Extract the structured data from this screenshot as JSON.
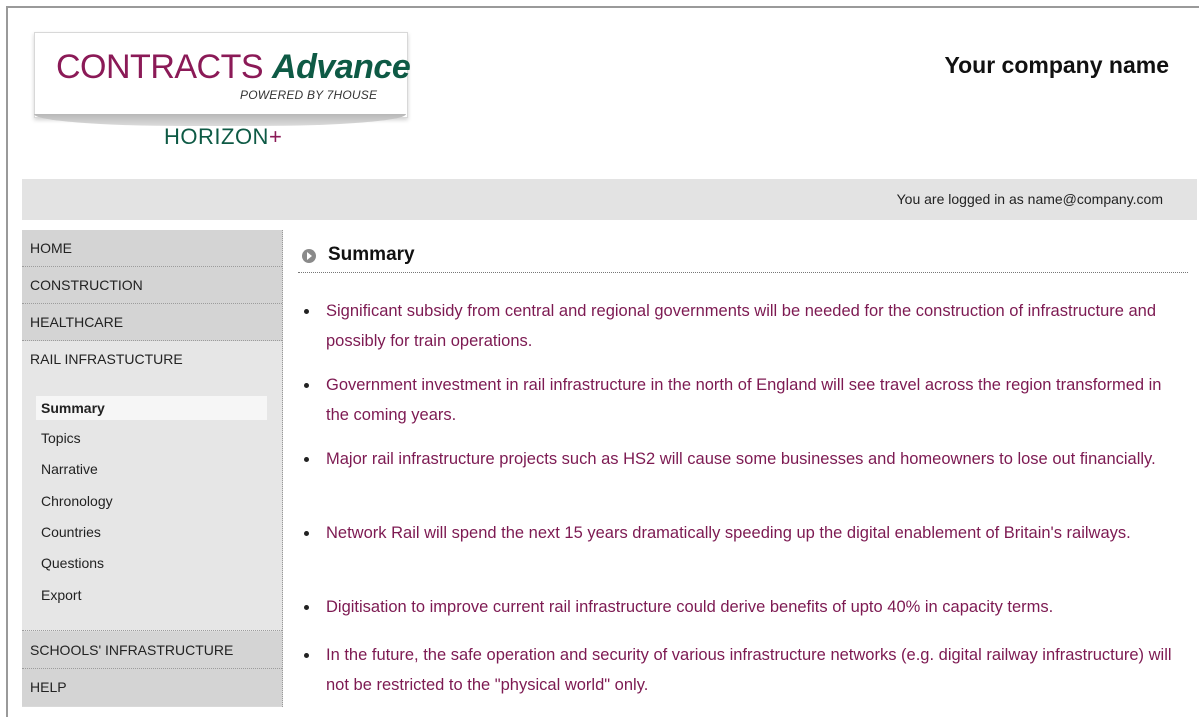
{
  "header": {
    "logo": {
      "contracts": "CONTRACTS",
      "advance": "Advance",
      "powered_by": "POWERED BY 7HOUSE",
      "horizon": "HORIZON",
      "horizon_plus": "+"
    },
    "company_name": "Your company name"
  },
  "login_bar": {
    "text": "You are logged in as name@company.com"
  },
  "sidebar": {
    "items": [
      {
        "label": "HOME"
      },
      {
        "label": "CONSTRUCTION"
      },
      {
        "label": "HEALTHCARE"
      },
      {
        "label": "RAIL INFRASTUCTURE"
      },
      {
        "label": "SCHOOLS' INFRASTRUCTURE"
      },
      {
        "label": "HELP"
      }
    ],
    "submenu": [
      {
        "label": "Summary",
        "selected": true
      },
      {
        "label": "Topics"
      },
      {
        "label": "Narrative"
      },
      {
        "label": "Chronology"
      },
      {
        "label": "Countries"
      },
      {
        "label": "Questions"
      },
      {
        "label": "Export"
      }
    ]
  },
  "main": {
    "title": "Summary",
    "bullets": [
      {
        "text": "Significant subsidy from central and regional governments will be needed for the construction of infrastructure and possibly for train operations."
      },
      {
        "text": "Government investment in rail infrastructure in the north of England will see travel across the region transformed in the coming years."
      },
      {
        "text": "Major rail infrastructure projects such as HS2 will cause some businesses and homeowners to lose out financially."
      },
      {
        "text": "Network Rail will spend the next 15 years dramatically speeding up the digital enablement of Britain's railways."
      },
      {
        "text": "Digitisation to improve current rail infrastructure could derive benefits of upto 40% in capacity terms."
      },
      {
        "text": "In the future, the safe operation and security of various infrastructure networks (e.g. digital railway infrastructure) will not be restricted to the \"physical world\" only."
      }
    ]
  },
  "colors": {
    "accent_magenta": "#8b1a57",
    "accent_green": "#0e5a45",
    "bullet_text": "#7d1a52",
    "sidebar_bg": "#d9d9d9",
    "login_bar_bg": "#e3e3e3"
  }
}
